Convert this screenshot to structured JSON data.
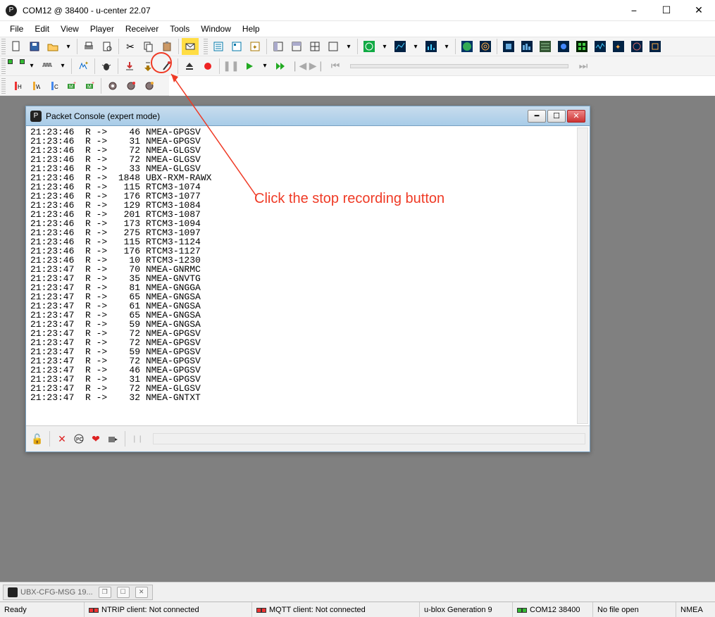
{
  "window": {
    "title": "COM12 @ 38400 - u-center 22.07",
    "controls": {
      "min": "−",
      "max": "☐",
      "close": "✕"
    }
  },
  "menu": [
    "File",
    "Edit",
    "View",
    "Player",
    "Receiver",
    "Tools",
    "Window",
    "Help"
  ],
  "toolbar_hints": {
    "new": "📄",
    "save": "💾",
    "open": "📂",
    "print": "🖨",
    "preview": "📑",
    "cut": "✂",
    "copy": "📋",
    "paste": "📋",
    "msg": "✉"
  },
  "child_window": {
    "title": "Packet Console (expert mode)"
  },
  "console_lines": [
    "21:23:46  R ->    46 NMEA-GPGSV",
    "21:23:46  R ->    31 NMEA-GPGSV",
    "21:23:46  R ->    72 NMEA-GLGSV",
    "21:23:46  R ->    72 NMEA-GLGSV",
    "21:23:46  R ->    33 NMEA-GLGSV",
    "21:23:46  R ->  1848 UBX-RXM-RAWX",
    "21:23:46  R ->   115 RTCM3-1074",
    "21:23:46  R ->   176 RTCM3-1077",
    "21:23:46  R ->   129 RTCM3-1084",
    "21:23:46  R ->   201 RTCM3-1087",
    "21:23:46  R ->   173 RTCM3-1094",
    "21:23:46  R ->   275 RTCM3-1097",
    "21:23:46  R ->   115 RTCM3-1124",
    "21:23:46  R ->   176 RTCM3-1127",
    "21:23:46  R ->    10 RTCM3-1230",
    "21:23:47  R ->    70 NMEA-GNRMC",
    "21:23:47  R ->    35 NMEA-GNVTG",
    "21:23:47  R ->    81 NMEA-GNGGA",
    "21:23:47  R ->    65 NMEA-GNGSA",
    "21:23:47  R ->    61 NMEA-GNGSA",
    "21:23:47  R ->    65 NMEA-GNGSA",
    "21:23:47  R ->    59 NMEA-GNGSA",
    "21:23:47  R ->    72 NMEA-GPGSV",
    "21:23:47  R ->    72 NMEA-GPGSV",
    "21:23:47  R ->    59 NMEA-GPGSV",
    "21:23:47  R ->    72 NMEA-GPGSV",
    "21:23:47  R ->    46 NMEA-GPGSV",
    "21:23:47  R ->    31 NMEA-GPGSV",
    "21:23:47  R ->    72 NMEA-GLGSV",
    "21:23:47  R ->    32 NMEA-GNTXT"
  ],
  "annotation": {
    "text": "Click the stop recording button"
  },
  "mdi_tab": {
    "label": "UBX-CFG-MSG 19..."
  },
  "statusbar": {
    "ready": "Ready",
    "ntrip": "NTRIP client: Not connected",
    "mqtt": "MQTT client: Not connected",
    "gen": "u-blox Generation 9",
    "port": "COM12 38400",
    "file": "No file open",
    "proto": "NMEA"
  }
}
